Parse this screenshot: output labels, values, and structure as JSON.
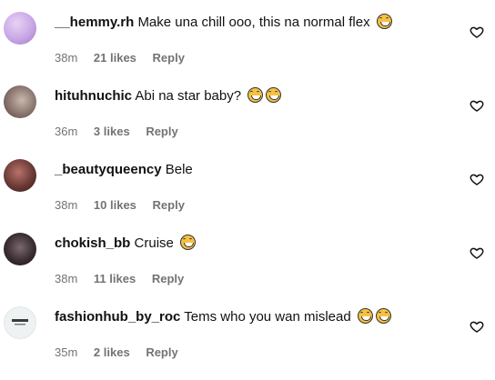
{
  "comments": [
    {
      "username": "__hemmy.rh",
      "text": "Make una chill ooo, this na normal flex",
      "emojis": [
        "grinning-squint-face"
      ],
      "time": "38m",
      "likes": "21 likes",
      "reply": "Reply",
      "avatar_color": "#c9a6e6"
    },
    {
      "username": "hituhnuchic",
      "text": "Abi na star baby?",
      "emojis": [
        "grinning-squint-face",
        "grinning-squint-face"
      ],
      "time": "36m",
      "likes": "3 likes",
      "reply": "Reply",
      "avatar_color": "#8f7a72"
    },
    {
      "username": "_beautyqueency",
      "text": "Bele",
      "emojis": [],
      "time": "38m",
      "likes": "10 likes",
      "reply": "Reply",
      "avatar_color": "#6b3a36"
    },
    {
      "username": "chokish_bb",
      "text": "Cruise",
      "emojis": [
        "grinning-squint-face"
      ],
      "time": "38m",
      "likes": "11 likes",
      "reply": "Reply",
      "avatar_color": "#3b2f33"
    },
    {
      "username": "fashionhub_by_roc",
      "text": "Tems who you wan mislead",
      "emojis": [
        "grinning-squint-face",
        "grinning-squint-face"
      ],
      "time": "35m",
      "likes": "2 likes",
      "reply": "Reply",
      "avatar_color": "#e9eef0"
    }
  ]
}
